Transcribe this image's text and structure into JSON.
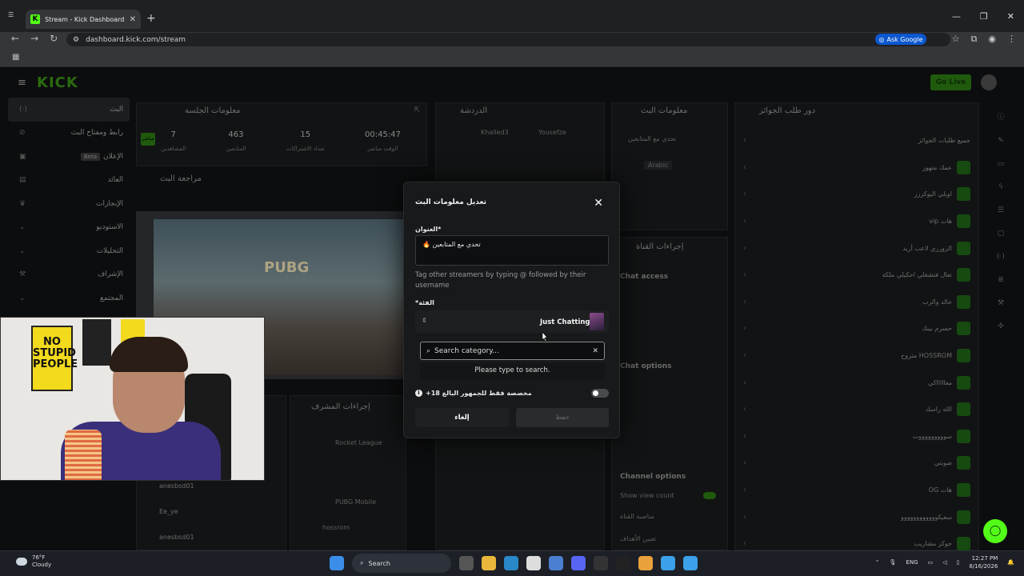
{
  "browser": {
    "tab_title": "Stream - Kick Dashboard",
    "url": "dashboard.kick.com/stream",
    "ask_google": "Ask Google"
  },
  "header": {
    "logo": "KICK",
    "go_live": "Go Live"
  },
  "sidebar": {
    "items": [
      {
        "label": "البث"
      },
      {
        "label": "رابط ومفتاح البث"
      },
      {
        "label": "الإعلان",
        "badge": "Beta"
      },
      {
        "label": "العائد"
      },
      {
        "label": "الإنجازات"
      },
      {
        "label": "الاستوديو"
      },
      {
        "label": "التحليلات"
      },
      {
        "label": "الإشراف"
      },
      {
        "label": "المجتمع"
      }
    ]
  },
  "session": {
    "title": "معلومات الجلسة",
    "live_chip": "مباشر",
    "stats": [
      {
        "value": "7",
        "label": "المشاهدين"
      },
      {
        "value": "463",
        "label": "المتابعين"
      },
      {
        "value": "15",
        "label": "تعداد الاشتراكات"
      },
      {
        "value": "00:45:47",
        "label": "الوقت مباشر"
      }
    ],
    "review_title": "مراجعة البث"
  },
  "chat": {
    "title": "الدردشة",
    "users": [
      "Khalled3",
      "Yousefze"
    ]
  },
  "stream_info": {
    "title": "معلومات البث",
    "stream_title": "تحدي مع المتابعين",
    "language": "Arabic"
  },
  "channel_actions": {
    "title": "إجراءات القناة",
    "chat_access": "Chat access",
    "chat_options": "Chat options",
    "channel_options": "Channel options",
    "show_view_count": "Show view count",
    "channel_manager": "مناصبة القناة",
    "goals": "تعيين الأهداف"
  },
  "queue": {
    "title": "دور طلب الجوائز",
    "items": [
      {
        "name": "جميع طلبات الجوائز"
      },
      {
        "name": "عمك متهوز"
      },
      {
        "name": "اوبلي اليوكرزز"
      },
      {
        "name": "هات vip"
      },
      {
        "name": "الرورري لاعب أريد"
      },
      {
        "name": "تعال فتشغلي احكيلي ملكة"
      },
      {
        "name": "خالد والرب"
      },
      {
        "name": "حسرم بيبك"
      },
      {
        "name": "HOSSROM متروح"
      },
      {
        "name": "معاااااكي"
      },
      {
        "name": "الله راسك"
      },
      {
        "name": "سوووووووووت"
      },
      {
        "name": "صوبني"
      },
      {
        "name": "هات OG"
      },
      {
        "name": "سعيكوووووووووووو"
      },
      {
        "name": "جوكر مشاريب"
      }
    ]
  },
  "moderation": {
    "title": "إجراءات المشرف",
    "events": [
      "Rocket League",
      "PUBG Mobile",
      "hossrom"
    ],
    "users": [
      "anesbsd01",
      "Ee_ye",
      "anesbsd01"
    ]
  },
  "modal": {
    "title": "تعديل معلومات البث",
    "title_label": "*العنوان",
    "title_value": "تحدي مع المتابعين 🔥",
    "help_text": "Tag other streamers by typing @ followed by their username",
    "category_label": "*الفئة",
    "category_value": "Just Chatting",
    "search_placeholder": "Search category...",
    "search_hint": "Please type to search.",
    "mature_label": "+مخصصة فقط للجمهور البالغ 18",
    "cancel": "إلغاء",
    "save": "حفظ"
  },
  "taskbar": {
    "temp": "76°F",
    "weather": "Cloudy",
    "search": "Search",
    "lang": "ENG",
    "time": "12:27 PM",
    "date": "8/16/2026"
  },
  "colors": {
    "accent": "#53fc18",
    "modal_bg": "#18191b",
    "page_bg": "#0c0d0e"
  }
}
